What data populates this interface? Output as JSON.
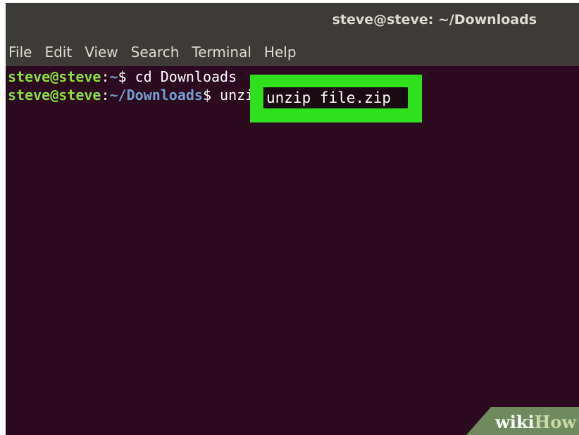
{
  "window": {
    "title": "steve@steve: ~/Downloads"
  },
  "menubar": {
    "items": [
      "File",
      "Edit",
      "View",
      "Search",
      "Terminal",
      "Help"
    ]
  },
  "terminal": {
    "lines": [
      {
        "user": "steve@steve",
        "colon": ":",
        "path": "~",
        "prompt": "$ ",
        "command": "cd Downloads"
      },
      {
        "user": "steve@steve",
        "colon": ":",
        "path": "~/Downloads",
        "prompt": "$ ",
        "command": "unzip file.zip"
      }
    ]
  },
  "highlight": {
    "text": "unzip file.zip",
    "color": "#2fe11d"
  },
  "watermark": {
    "part1": "wiki",
    "part2": "How"
  },
  "colors": {
    "titlebar": "#3c3b37",
    "terminal_bg": "#2c0a20",
    "user": "#8ae234",
    "path": "#729fcf"
  }
}
